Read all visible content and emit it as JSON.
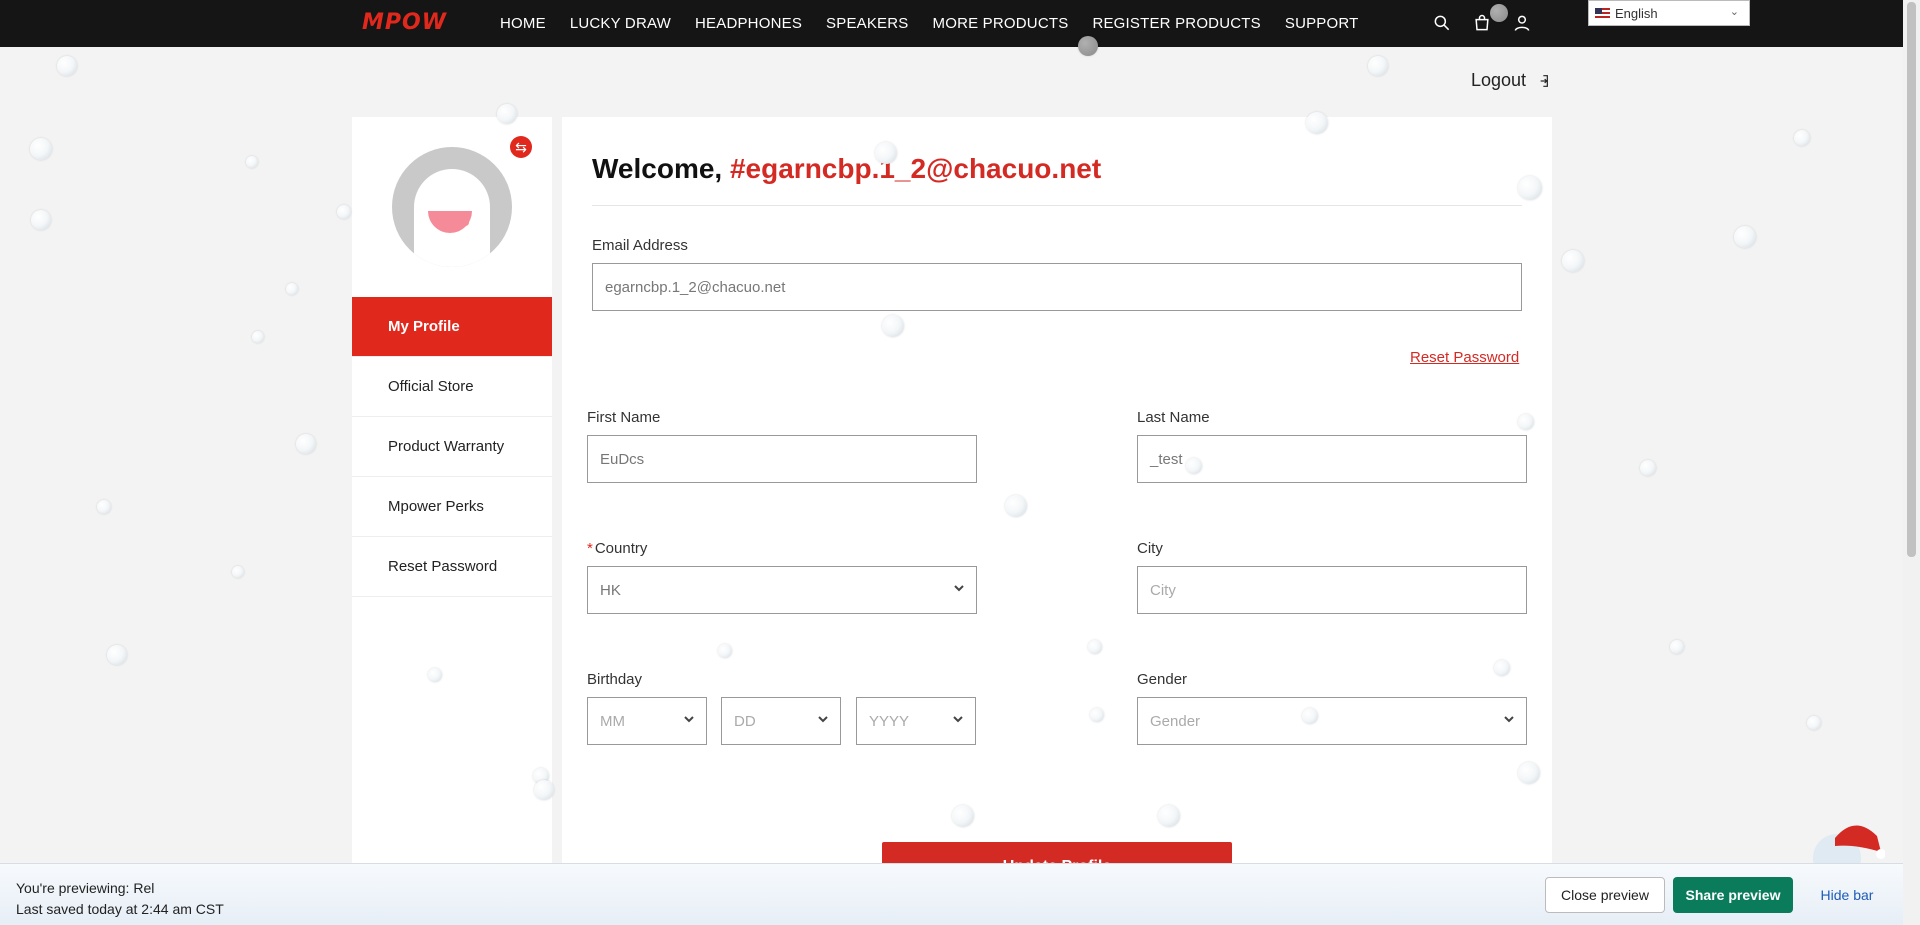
{
  "brand": {
    "logo_text": "MPOW",
    "accent": "#e0281d"
  },
  "nav": {
    "items": [
      "HOME",
      "LUCKY DRAW",
      "HEADPHONES",
      "SPEAKERS",
      "MORE PRODUCTS",
      "REGISTER PRODUCTS",
      "SUPPORT"
    ],
    "icons": [
      "search-icon",
      "cart-icon",
      "user-icon"
    ]
  },
  "language": {
    "selected": "English"
  },
  "account": {
    "logout_label": "Logout"
  },
  "sidebar": {
    "items": [
      {
        "label": "My Profile",
        "active": true
      },
      {
        "label": "Official Store",
        "active": false
      },
      {
        "label": "Product Warranty",
        "active": false
      },
      {
        "label": "Mpower Perks",
        "active": false
      },
      {
        "label": "Reset Password",
        "active": false
      }
    ]
  },
  "profile": {
    "welcome_prefix": "Welcome,",
    "welcome_email": "#egarncbp.1_2@chacuo.net",
    "email_label": "Email Address",
    "email_value": "egarncbp.1_2@chacuo.net",
    "reset_password_link": "Reset Password",
    "first_name_label": "First Name",
    "first_name_value": "EuDcs",
    "last_name_label": "Last Name",
    "last_name_value": "_test",
    "country_label": "Country",
    "country_required": "*",
    "country_value": "HK",
    "city_label": "City",
    "city_placeholder": "City",
    "birthday_label": "Birthday",
    "birthday_month_placeholder": "MM",
    "birthday_day_placeholder": "DD",
    "birthday_year_placeholder": "YYYY",
    "gender_label": "Gender",
    "gender_placeholder": "Gender",
    "update_button": "Update Profile"
  },
  "preview_bar": {
    "previewing_prefix": "You're previewing:",
    "previewing_name": "Rel",
    "saved_text": "Last saved today at 2:44 am CST",
    "close_label": "Close preview",
    "share_label": "Share preview",
    "hide_label": "Hide bar"
  }
}
